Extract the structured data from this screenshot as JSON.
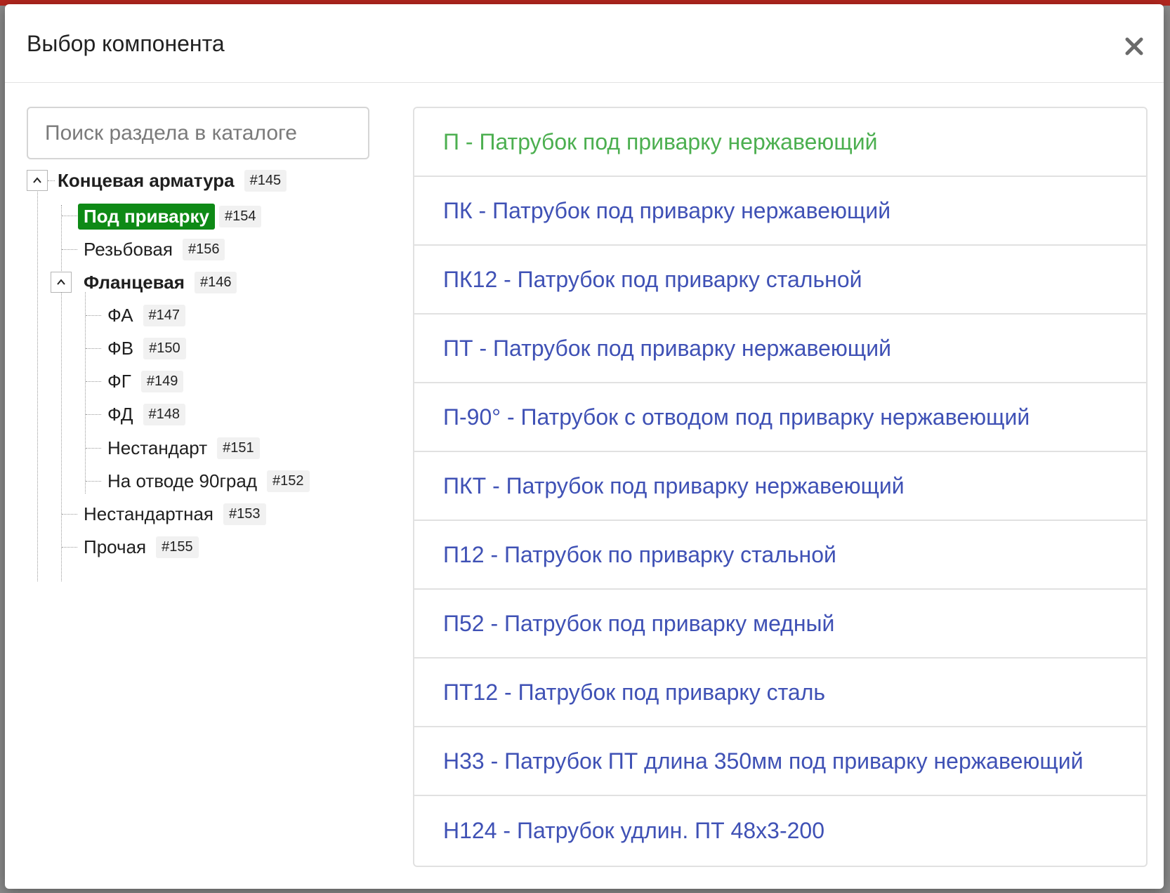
{
  "modal": {
    "title": "Выбор компонента",
    "close_icon": "close-icon"
  },
  "search": {
    "placeholder": "Поиск раздела в каталоге"
  },
  "tree": {
    "root": {
      "label": "Концевая арматура",
      "id": "#145",
      "expanded": true
    },
    "children": [
      {
        "label": "Под приварку",
        "id": "#154",
        "active": true
      },
      {
        "label": "Резьбовая",
        "id": "#156"
      },
      {
        "label": "Фланцевая",
        "id": "#146",
        "expanded": true,
        "children": [
          {
            "label": "ФА",
            "id": "#147"
          },
          {
            "label": "ФВ",
            "id": "#150"
          },
          {
            "label": "ФГ",
            "id": "#149"
          },
          {
            "label": "ФД",
            "id": "#148"
          },
          {
            "label": "Нестандарт",
            "id": "#151"
          },
          {
            "label": "На отводе 90град",
            "id": "#152"
          }
        ]
      },
      {
        "label": "Нестандартная",
        "id": "#153"
      },
      {
        "label": "Прочая",
        "id": "#155"
      }
    ]
  },
  "components": [
    "П - Патрубок под приварку нержавеющий",
    "ПК - Патрубок под приварку нержавеющий",
    "ПК12 - Патрубок под приварку стальной",
    "ПТ - Патрубок под приварку нержавеющий",
    "П-90° - Патрубок с отводом под приварку нержавеющий",
    "ПКТ - Патрубок под приварку нержавеющий",
    "П12 - Патрубок по приварку стальной",
    "П52 - Патрубок под приварку медный",
    "ПТ12 - Патрубок под приварку сталь",
    "Н33 - Патрубок ПТ длина 350мм под приварку нержавеющий",
    "Н124 - Патрубок удлин. ПТ 48х3-200"
  ],
  "colors": {
    "link": "#3f51b5",
    "selected_link": "#4caf50",
    "active_node_bg": "#0e8a16"
  }
}
